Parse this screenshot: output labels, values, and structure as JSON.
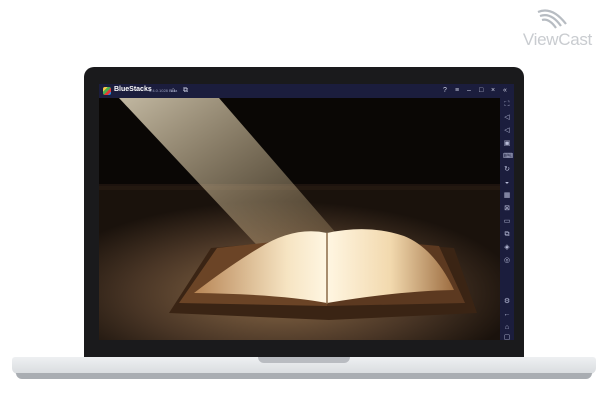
{
  "watermark": {
    "text": "ViewCast"
  },
  "emulator": {
    "app_name": "BlueStacks",
    "version": "5.4.0.1028 Beta",
    "titlebar_icons": [
      "home-icon",
      "multi-instance-icon",
      "help-icon",
      "menu-icon",
      "minimize-icon",
      "maximize-icon",
      "close-icon",
      "collapse-sidebar-icon"
    ],
    "sidebar_icons": [
      "fullscreen-icon",
      "volume-up-icon",
      "volume-down-icon",
      "media-icon",
      "keyboard-icon",
      "rotate-icon",
      "shake-icon",
      "screenshot-icon",
      "record-icon",
      "folder-icon",
      "apk-install-icon",
      "macro-icon",
      "eco-mode-icon",
      "settings-icon",
      "back-icon",
      "home-icon",
      "recents-icon"
    ]
  },
  "scene": {
    "description_colors": {
      "dark": "#0b0806",
      "light": "#f3d9a8",
      "table": "#6b4f36"
    }
  }
}
